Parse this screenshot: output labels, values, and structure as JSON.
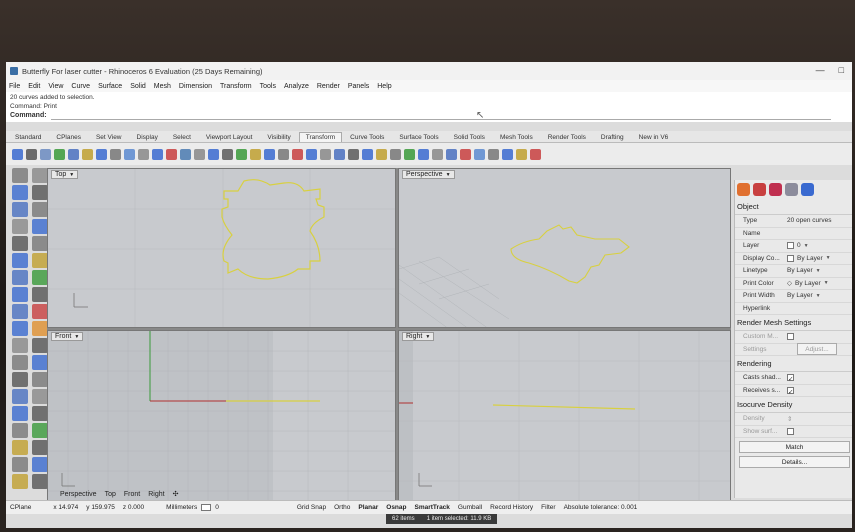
{
  "window": {
    "title": "Butterfly For laser cutter - Rhinoceros 6 Evaluation (25 Days Remaining)",
    "min": "—",
    "max": "□"
  },
  "menu": [
    "File",
    "Edit",
    "View",
    "Curve",
    "Surface",
    "Solid",
    "Mesh",
    "Dimension",
    "Transform",
    "Tools",
    "Analyze",
    "Render",
    "Panels",
    "Help"
  ],
  "command": {
    "history1": "20 curves added to selection.",
    "history2": "Command: Print",
    "prompt": "Command:",
    "value": ""
  },
  "tabs": [
    "Standard",
    "CPlanes",
    "Set View",
    "Display",
    "Select",
    "Viewport Layout",
    "Visibility",
    "Transform",
    "Curve Tools",
    "Surface Tools",
    "Solid Tools",
    "Mesh Tools",
    "Render Tools",
    "Drafting",
    "New in V6"
  ],
  "active_tab": "Transform",
  "viewports": {
    "top": "Top",
    "perspective": "Perspective",
    "front": "Front",
    "right": "Right"
  },
  "viewport_tabs": [
    "Perspective",
    "Top",
    "Front",
    "Right"
  ],
  "panel": {
    "object_header": "Object",
    "properties": [
      {
        "key": "Type",
        "value": "20 open curves"
      },
      {
        "key": "Name",
        "value": ""
      },
      {
        "key": "Layer",
        "value": "0"
      },
      {
        "key": "Display Co...",
        "value": "By Layer"
      },
      {
        "key": "Linetype",
        "value": "By Layer"
      },
      {
        "key": "Print Color",
        "value": "By Layer"
      },
      {
        "key": "Print Width",
        "value": "By Layer"
      },
      {
        "key": "Hyperlink",
        "value": ""
      }
    ],
    "render_mesh_header": "Render Mesh Settings",
    "custom_mesh": "Custom M...",
    "settings": "Settings",
    "adjust": "Adjust...",
    "rendering_header": "Rendering",
    "casts_shadows": "Casts shad...",
    "receives_shadows": "Receives s...",
    "isocurve_header": "Isocurve Density",
    "density": "Density",
    "show_surface": "Show surf...",
    "match": "Match",
    "details": "Details..."
  },
  "status": {
    "cplane": "CPlane",
    "x": "x 14.974",
    "y": "y 159.975",
    "z": "z 0.000",
    "units": "Millimeters",
    "layer": "0",
    "grid_snap": "Grid Snap",
    "ortho": "Ortho",
    "planar": "Planar",
    "osnap": "Osnap",
    "smarttrack": "SmartTrack",
    "gumball": "Gumball",
    "record_history": "Record History",
    "filter": "Filter",
    "tolerance": "Absolute tolerance: 0.001",
    "items": "62 items",
    "selected": "1 item selected: 11.9 KB"
  },
  "colors": {
    "curve": "#d8d040",
    "viewport_bg": "#c8cace",
    "grid": "#b4b7bb"
  }
}
